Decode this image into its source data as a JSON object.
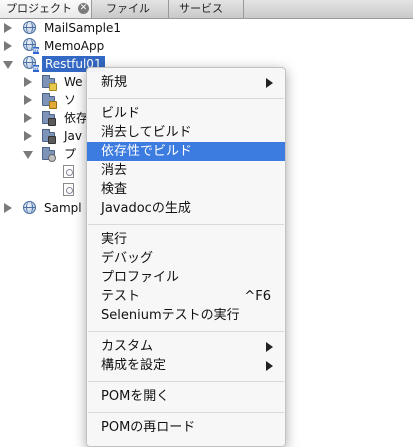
{
  "tabs": [
    {
      "label": "プロジェクト",
      "active": true
    },
    {
      "label": "ファイル",
      "active": false
    },
    {
      "label": "サービス",
      "active": false
    }
  ],
  "tree": {
    "mail_sample": "MailSample1",
    "memo_app": "MemoApp",
    "restful": "Restful01",
    "child1": "We",
    "child2": "ソ",
    "child3": "依存",
    "child4": "Jav",
    "child5": "プ",
    "sample": "Sampl"
  },
  "menu": {
    "new": "新規",
    "build": "ビルド",
    "clean_build": "消去してビルド",
    "build_deps": "依存性でビルド",
    "clean": "消去",
    "check": "検査",
    "javadoc": "Javadocの生成",
    "run": "実行",
    "debug": "デバッグ",
    "profile": "プロファイル",
    "test": "テスト",
    "test_shortcut": "^F6",
    "selenium": "Seleniumテストの実行",
    "custom": "カスタム",
    "config": "構成を設定",
    "open_pom": "POMを開く",
    "reload_pom": "POMの再ロード"
  },
  "colors": {
    "selection": "#3468c5",
    "menu_highlight": "#3c7be0"
  }
}
